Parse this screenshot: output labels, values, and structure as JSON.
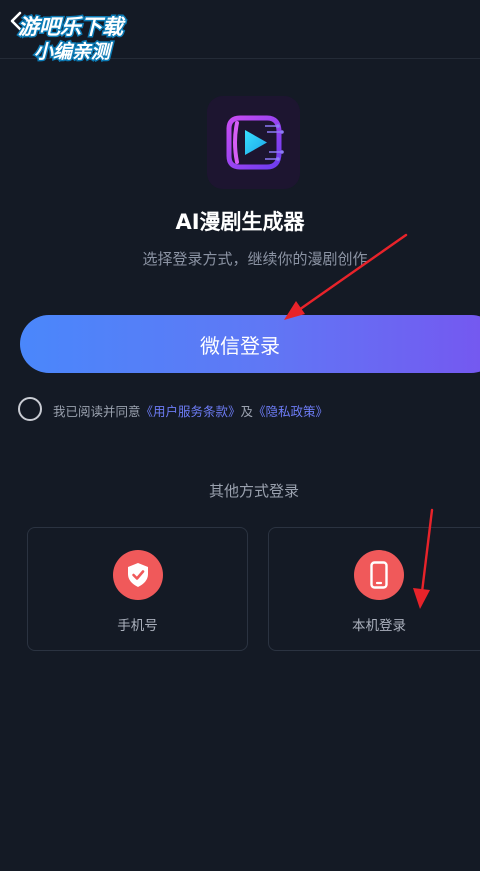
{
  "watermark": {
    "line1": "游吧乐下载",
    "line2": "小编亲测"
  },
  "app": {
    "name": "AI漫剧生成器",
    "subtitle": "选择登录方式，继续你的漫剧创作"
  },
  "login": {
    "wechat_label": "微信登录"
  },
  "agreement": {
    "prefix": "我已阅读并同意",
    "terms_link": "《用户服务条款》",
    "conjunction": "及",
    "privacy_link": "《隐私政策》"
  },
  "other": {
    "title": "其他方式登录",
    "options": [
      {
        "label": "手机号",
        "icon": "shield-check-icon"
      },
      {
        "label": "本机登录",
        "icon": "smartphone-icon"
      }
    ]
  },
  "colors": {
    "background": "#141a25",
    "button_gradient_start": "#4a87fb",
    "button_gradient_end": "#7656f0",
    "option_icon": "#f0595a",
    "link": "#6d7cf5",
    "annotation_arrow": "#e8232a"
  }
}
